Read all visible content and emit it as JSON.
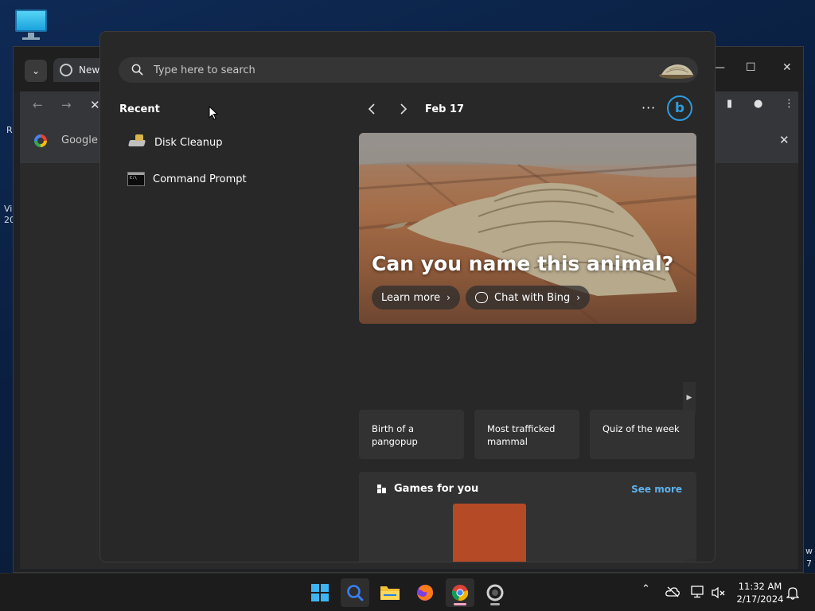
{
  "browser": {
    "tab_title": "New",
    "bookmark_text": "Google C",
    "nav_back": "←",
    "nav_forward": "→",
    "nav_stop": "✕",
    "close_bookmarks": "✕",
    "win_minimize": "—",
    "win_maximize": "☐",
    "win_close": "✕"
  },
  "desktop_fragments": {
    "left_a": "R",
    "left_b": "Vi",
    "left_c": "20",
    "right_a": "w",
    "right_b": "7"
  },
  "search": {
    "placeholder": "Type here to search"
  },
  "recent": {
    "title": "Recent",
    "items": [
      {
        "label": "Disk Cleanup",
        "icon": "disk-cleanup-icon"
      },
      {
        "label": "Command Prompt",
        "icon": "command-prompt-icon"
      }
    ]
  },
  "highlights": {
    "date": "Feb 17",
    "more": "···",
    "bing_letter": "b",
    "hero_title": "Can you name this animal?",
    "learn_more": "Learn more",
    "chat_with_bing": "Chat with Bing",
    "chevron": "›",
    "topics": [
      "Birth of a pangopup",
      "Most trafficked mammal",
      "Quiz of the week"
    ]
  },
  "games": {
    "title": "Games for you",
    "see_more": "See more"
  },
  "taskbar": {
    "time": "11:32 AM",
    "date": "2/17/2024"
  },
  "colors": {
    "accent": "#5fb2ee",
    "bing_blue": "#2e9be0",
    "panel_bg": "#282828",
    "taskbar_bg": "#1c1c1c"
  }
}
